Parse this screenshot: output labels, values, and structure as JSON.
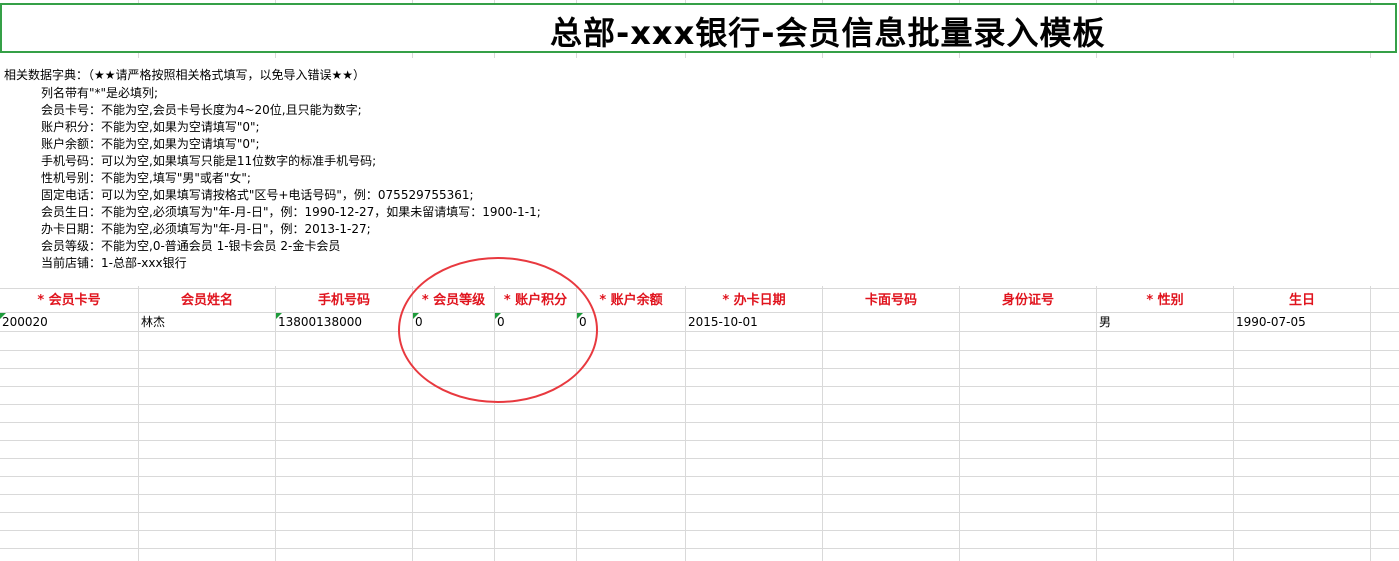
{
  "title": "总部-xxx银行-会员信息批量录入模板",
  "notes": [
    "相关数据字典：（★★请严格按照相关格式填写，以免导入错误★★）",
    "列名带有\"*\"是必填列;",
    "会员卡号：不能为空,会员卡号长度为4~20位,且只能为数字;",
    "账户积分：不能为空,如果为空请填写\"0\";",
    "账户余额：不能为空,如果为空请填写\"0\";",
    "手机号码：可以为空,如果填写只能是11位数字的标准手机号码;",
    "性机号别：不能为空,填写\"男\"或者\"女\";",
    "固定电话：可以为空,如果填写请按格式\"区号+电话号码\"，例：075529755361;",
    "会员生日：不能为空,必须填写为\"年-月-日\"，例：1990-12-27，如果未留请填写：1900-1-1;",
    "办卡日期：不能为空,必须填写为\"年-月-日\"，例：2013-1-27;",
    "会员等级：不能为空,0-普通会员  1-银卡会员  2-金卡会员",
    "当前店铺：1-总部-xxx银行"
  ],
  "columns": [
    "* 会员卡号",
    "会员姓名",
    "手机号码",
    "* 会员等级",
    "* 账户积分",
    "* 账户余额",
    "* 办卡日期",
    "卡面号码",
    "身份证号",
    "* 性别",
    "生日"
  ],
  "row": [
    "200020",
    "林杰",
    "13800138000",
    "0",
    "0",
    "0",
    "2015-10-01",
    "",
    "",
    "男",
    "1990-07-05"
  ],
  "colors": {
    "title_border": "#35a047",
    "header_text": "#e0141e",
    "annotation_circle": "#e8393f",
    "cell_marker": "#1e9b3b"
  }
}
